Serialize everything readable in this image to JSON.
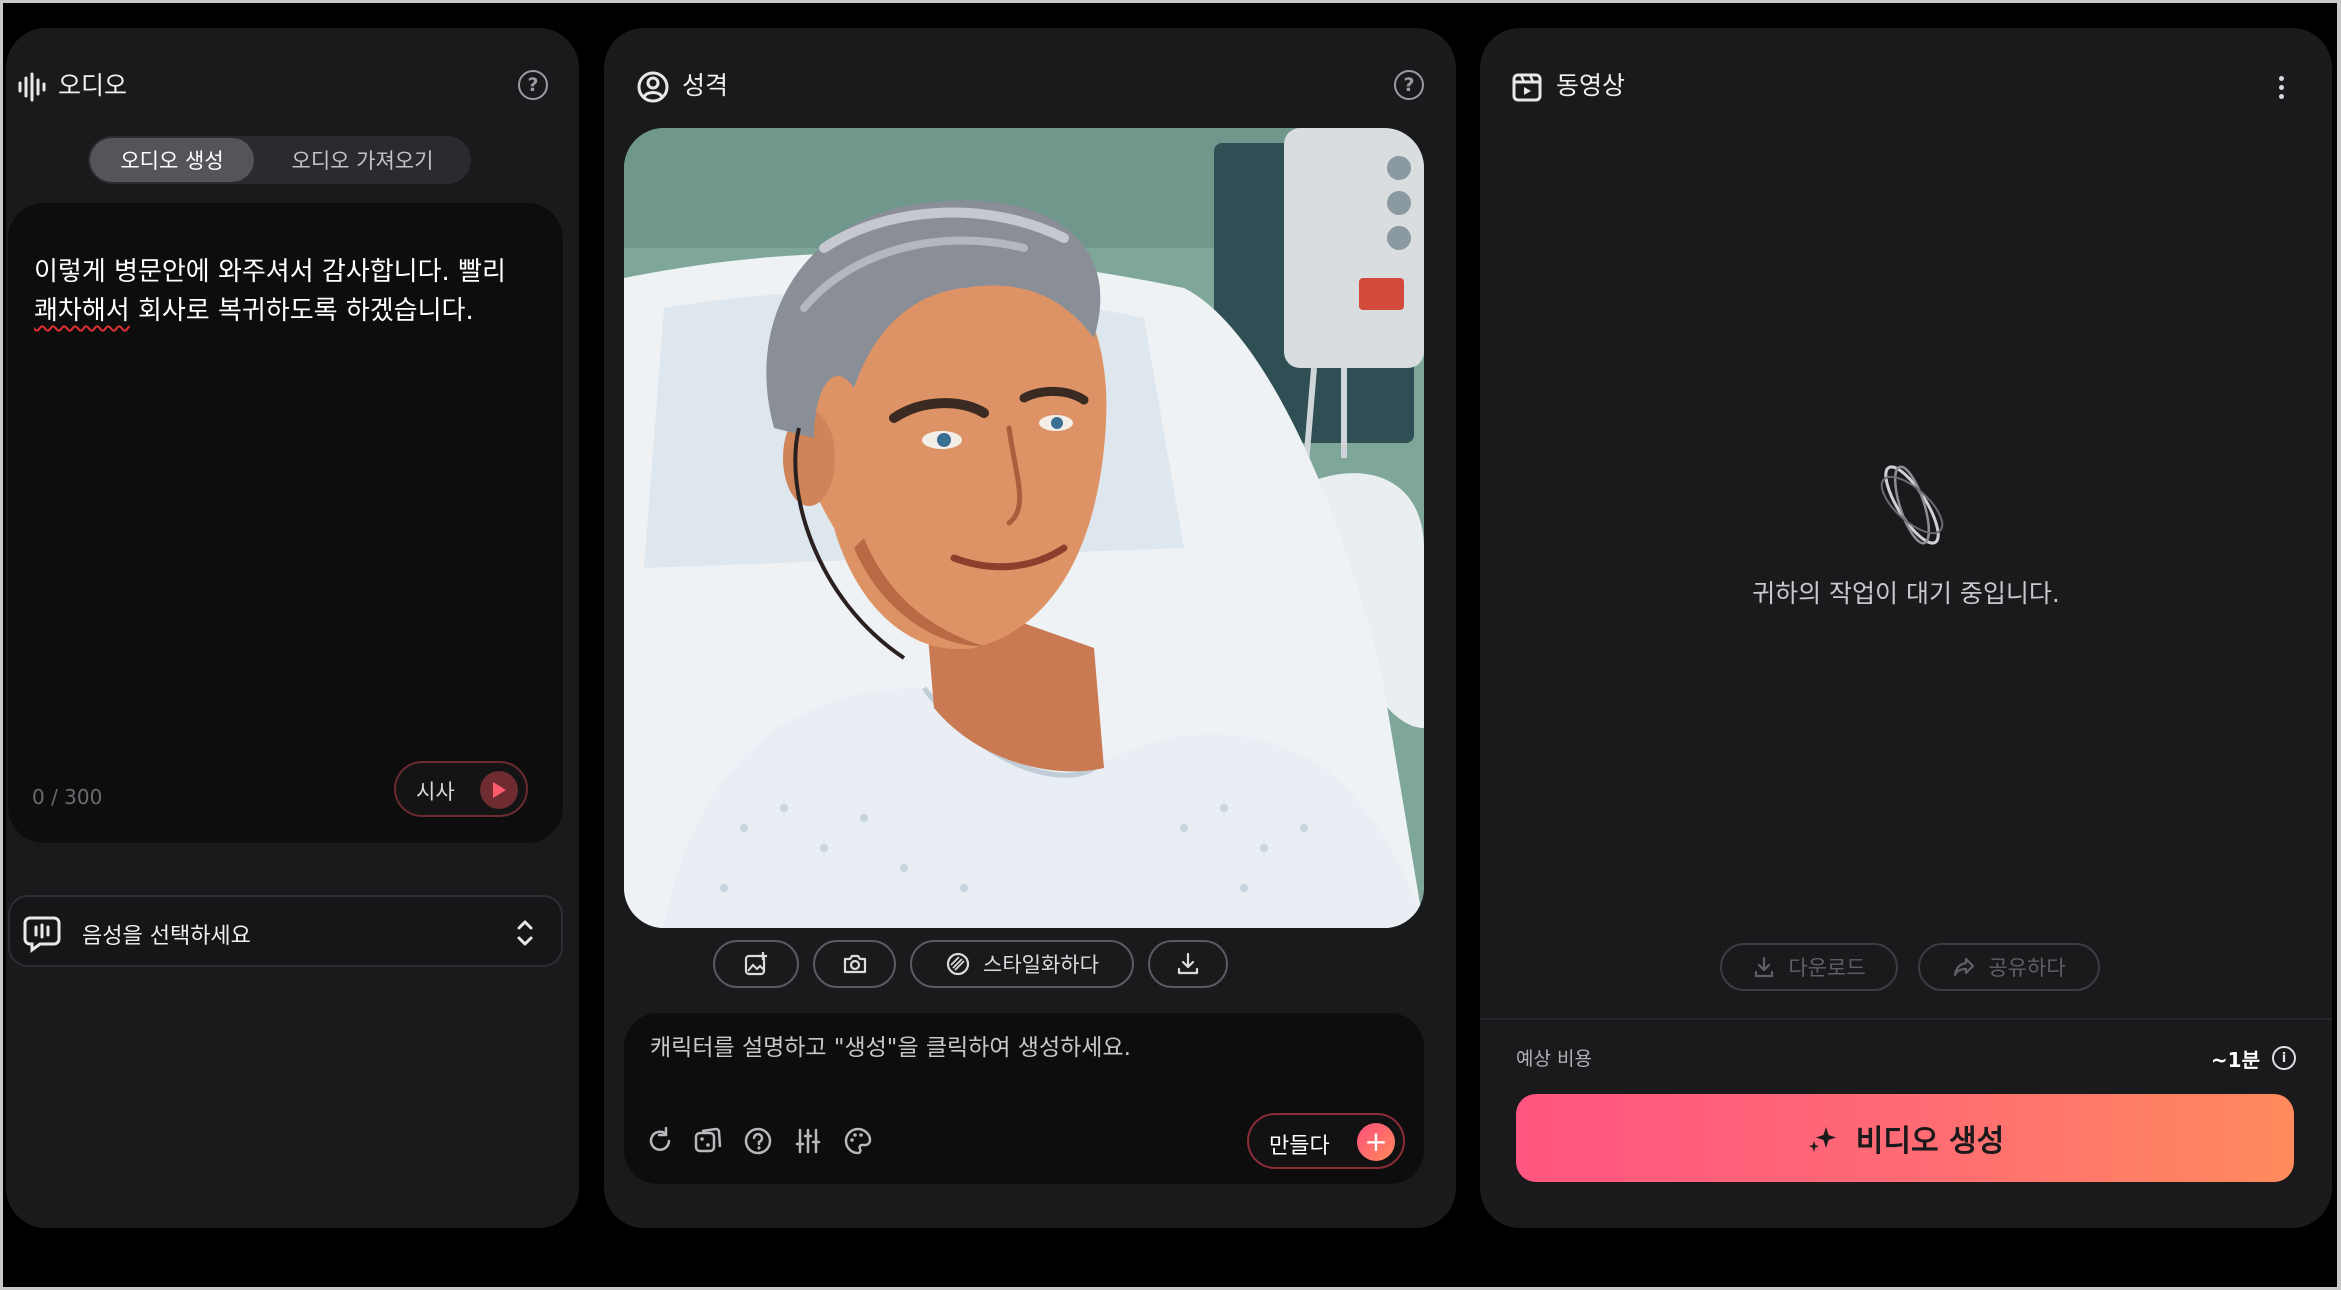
{
  "audio_panel": {
    "title": "오디오",
    "help_glyph": "?",
    "tabs": {
      "generate": "오디오 생성",
      "import": "오디오 가져오기"
    },
    "text_line1": "이렇게 병문안에 와주셔서 감사합니다. 빨리",
    "text_misspelled": "쾌차해서",
    "text_line2_rest": " 회사로 복귀하도록 하겠습니다.",
    "char_count": "0 / 300",
    "preview_label": "시사",
    "voice_select_label": "음성을 선택하세요"
  },
  "character_panel": {
    "title": "성격",
    "help_glyph": "?",
    "stylize_label": "스타일화하다",
    "prompt_placeholder": "캐릭터를 설명하고 \"생성\"을 클릭하여 생성하세요.",
    "make_label": "만들다",
    "make_glyph": "+"
  },
  "video_panel": {
    "title": "동영상",
    "waiting_text": "귀하의 작업이 대기 중입니다.",
    "download_label": "다운로드",
    "share_label": "공유하다",
    "cost_label": "예상 비용",
    "cost_value": "~1분",
    "info_glyph": "i",
    "generate_label": "비디오 생성"
  },
  "colors": {
    "accent_gradient_start": "#ff5581",
    "accent_gradient_end": "#ff8b5c",
    "panel_bg": "#1a1a1c",
    "inset_bg": "#0d0d0e"
  }
}
